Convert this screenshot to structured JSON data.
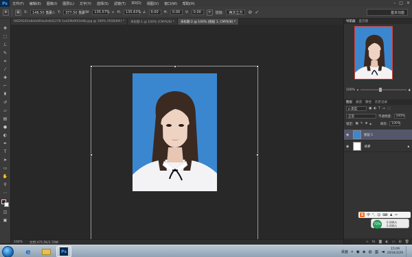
{
  "app": {
    "logo": "Ps",
    "menu": [
      "文件(F)",
      "编辑(E)",
      "图像(I)",
      "图层(L)",
      "文字(Y)",
      "选择(S)",
      "滤镜(T)",
      "3D(D)",
      "视图(V)",
      "窗口(W)",
      "帮助(H)"
    ],
    "window_controls": [
      "–",
      "□",
      "✕"
    ]
  },
  "options_bar": {
    "x_label": "X:",
    "x_value": "146.50 像素",
    "y_label": "Y:",
    "y_value": "377.50 像素",
    "w_label": "W:",
    "w_value": "135.57%",
    "h_label": "H:",
    "h_value": "135.63%",
    "angle_value": "0.00",
    "hskew_label": "H:",
    "hskew_value": "0.00",
    "vskew_label": "V:",
    "vskew_value": "0.00",
    "interp_label": "插值:",
    "interp_value": "两次立方",
    "workspace": "基本功能"
  },
  "tabs": [
    {
      "label": "fd029245e8ddd4fae4e6d1278 1ed29b9f43d4b.jpg @ 100% (RGB/8#) *",
      "active": false
    },
    {
      "label": "未标题-1 @ 100% (CMYK/8) *",
      "active": false
    },
    {
      "label": "未标题-2 @ 100% (图层 1, CMYK/8) *",
      "active": true
    }
  ],
  "status": {
    "zoom": "100%",
    "doc": "文档:475.5K/1.70M"
  },
  "navigator": {
    "tabs": [
      "导航器",
      "直方图"
    ],
    "zoom": "100%"
  },
  "layers_panel": {
    "tabs": [
      "图层",
      "通道",
      "路径",
      "历史记录"
    ],
    "kind_label": "ρ 类型",
    "blend_mode": "正常",
    "opacity_label": "不透明度:",
    "opacity_value": "100%",
    "lock_label": "锁定:",
    "fill_label": "填充:",
    "fill_value": "100%",
    "layers": [
      {
        "name": "图层 1",
        "selected": true
      },
      {
        "name": "背景",
        "selected": false
      }
    ],
    "footer_icons": [
      "link-icon",
      "fx-icon",
      "mask-icon",
      "adjustment-icon",
      "folder-icon",
      "new-layer-icon",
      "trash-icon"
    ]
  },
  "ime": {
    "label": "中",
    "net_percent": "72%",
    "up": "0.08K/s",
    "down": "0.08K/s"
  },
  "taskbar": {
    "desktop": "桌面",
    "time": "15:09",
    "date": "2016/3/29"
  },
  "colors": {
    "photo_background": "#3a87d0",
    "foreground_swatch": "#3d1e20",
    "layer_selected": "#54576a"
  }
}
